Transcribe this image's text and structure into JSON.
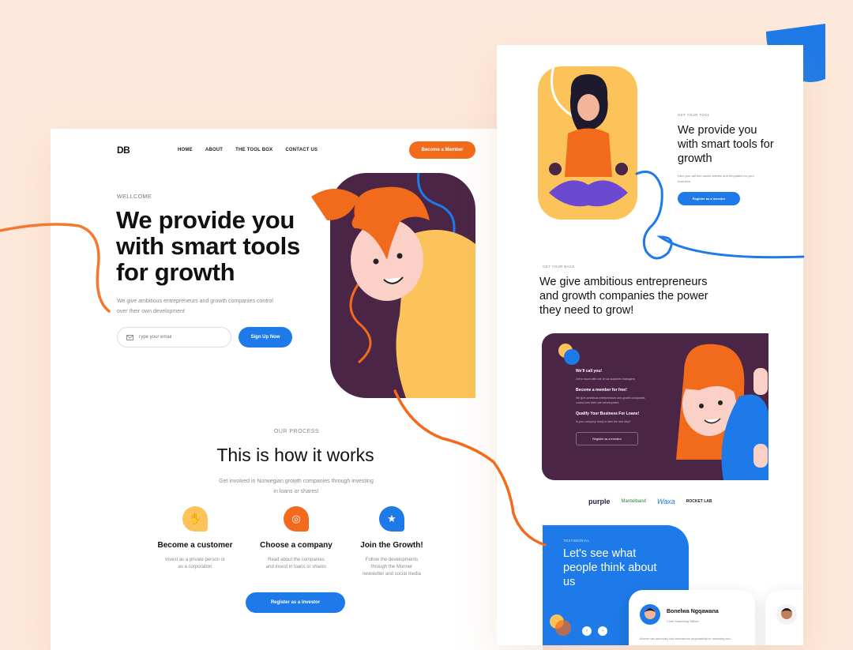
{
  "colors": {
    "background": "#fde9db",
    "orange": "#f26a1b",
    "blue": "#1d7ae8",
    "purple": "#4a2545",
    "yellow": "#fbc35a"
  },
  "landing": {
    "logo": "DB",
    "nav": [
      "HOME",
      "ABOUT",
      "THE TOOL BOX",
      "CONTACT US"
    ],
    "cta_member": "Become a Member",
    "eyebrow": "WELLCOME",
    "title": "We provide you with smart tools for growth",
    "subtitle": "We give ambitious entrepreneurs and growth companies control over their own development",
    "email_placeholder": "Type your email",
    "signup_button": "Sign Up Now",
    "process": {
      "eyebrow": "OUR PROCESS",
      "title": "This is how it works",
      "subtitle": "Get involved in Norwegian growth companies through investing in loans or shares!",
      "steps": [
        {
          "icon": "hand-icon",
          "title": "Become a customer",
          "desc": "Invest as a private person or as a corporation"
        },
        {
          "icon": "target-icon",
          "title": "Choose a company",
          "desc": "Read about the companies and invest in loans or shares"
        },
        {
          "icon": "star-icon",
          "title": "Join the Growth!",
          "desc": "Follow the developments through the Monner newsletter and social media"
        }
      ],
      "register_button": "Register as a investor"
    }
  },
  "detail": {
    "eyebrow": "GET YOUR TOOL",
    "title": "We provide you with smart tools for growth",
    "subtitle": "Here you will find useful articles and templates for your business.",
    "register_button": "Register as a investor",
    "eyebrow2": "GET YOUR BACK",
    "title2": "We give ambitious entrepreneurs and growth companies the power they need to grow!",
    "call_card": {
      "h1": "We'll call you!",
      "p1": "Get in touch with one of our customer managers",
      "h2": "Become a member for free!",
      "p2": "We give ambitious entrepreneurs and growth companies control over their own development",
      "h3": "Qualify Your Business For Loans!",
      "p3": "Is your company ready to take the next step?",
      "button": "Register as a investor"
    },
    "partner_logos": [
      "purple",
      "Mantelband",
      "Waxa",
      "ROCKET LAB"
    ],
    "testimonial": {
      "eyebrow": "TESTIMONIAL",
      "title": "Let's see what people think about us",
      "name": "Bonelwa Ngqawana",
      "role": "Chief Marketing Officer",
      "text": "Monner has previously had international responsibility for marketing and..."
    }
  }
}
